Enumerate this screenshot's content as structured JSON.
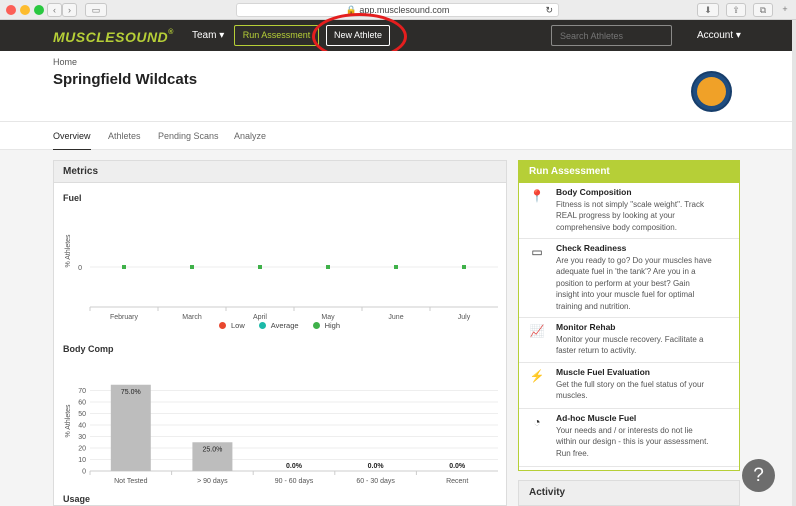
{
  "browser": {
    "url": "app.musclesound.com"
  },
  "nav": {
    "logo_text": "MUSCLESOUND",
    "logo_mark": "®",
    "team_label": "Team ▾",
    "run_assessment_label": "Run Assessment",
    "new_athlete_label": "New Athlete",
    "search_placeholder": "Search Athletes",
    "account_label": "Account ▾"
  },
  "header": {
    "breadcrumb": "Home",
    "title": "Springfield Wildcats"
  },
  "tabs": [
    {
      "label": "Overview",
      "active": true
    },
    {
      "label": "Athletes",
      "active": false
    },
    {
      "label": "Pending Scans",
      "active": false
    },
    {
      "label": "Analyze",
      "active": false
    }
  ],
  "metrics": {
    "title": "Metrics",
    "fuel_label": "Fuel",
    "body_comp_label": "Body Comp",
    "usage_label": "Usage",
    "legend": [
      {
        "label": "Low",
        "color": "#e8472f"
      },
      {
        "label": "Average",
        "color": "#1bb9a8"
      },
      {
        "label": "High",
        "color": "#3fb14a"
      }
    ]
  },
  "chart_data": [
    {
      "type": "scatter",
      "title": "Fuel",
      "ylabel": "% Athletes",
      "categories": [
        "February",
        "March",
        "April",
        "May",
        "June",
        "July"
      ],
      "series": [
        {
          "name": "High",
          "values": [
            0,
            0,
            0,
            0,
            0,
            0
          ],
          "color": "#3fb14a"
        }
      ],
      "yticks": [
        "0"
      ]
    },
    {
      "type": "bar",
      "title": "Body Comp",
      "ylabel": "% Athletes",
      "categories": [
        "Not Tested",
        "> 90 days",
        "90 - 60 days",
        "60 - 30 days",
        "Recent"
      ],
      "values": [
        75,
        25,
        0,
        0,
        0
      ],
      "data_labels": [
        "75.0%",
        "25.0%",
        "0.0%",
        "0.0%",
        "0.0%"
      ],
      "yticks": [
        "0",
        "10",
        "20",
        "30",
        "40",
        "50",
        "60",
        "70"
      ],
      "ylim": [
        0,
        80
      ],
      "color": "#bdbdbd"
    }
  ],
  "run_assessment": {
    "title": "Run Assessment",
    "items": [
      {
        "title": "Body Composition",
        "icon": "map-pin-icon",
        "glyph": "📍",
        "lines": [
          "Fitness is not simply \"scale weight\". Track",
          "REAL progress by looking at your",
          "comprehensive body composition."
        ]
      },
      {
        "title": "Check Readiness",
        "icon": "battery-icon",
        "glyph": "▭",
        "lines": [
          "Are you ready to go? Do your muscles have",
          "adequate fuel in 'the tank'? Are you in a",
          "position to perform at your best? Gain",
          "insight into your muscle fuel for optimal",
          "training and nutrition."
        ]
      },
      {
        "title": "Monitor Rehab",
        "icon": "trend-line-icon",
        "glyph": "📈",
        "lines": [
          "Monitor your muscle recovery. Facilitate a",
          "faster return to activity."
        ]
      },
      {
        "title": "Muscle Fuel Evaluation",
        "icon": "lightning-icon",
        "glyph": "⚡",
        "lines": [
          "Get the full story on the fuel status of your",
          "muscles."
        ]
      },
      {
        "title": "Ad-hoc Muscle Fuel",
        "icon": "gauge-icon",
        "glyph": "◔",
        "lines": [
          "Your needs and / or interests do not lie",
          "within our design - this is your assessment.",
          "Run free."
        ]
      }
    ]
  },
  "activity": {
    "title": "Activity"
  },
  "help": {
    "label": "?"
  },
  "colors": {
    "brand": "#b6cf37",
    "nav_bg": "#2d2c2a",
    "highlight_circle": "#e41e1e"
  }
}
